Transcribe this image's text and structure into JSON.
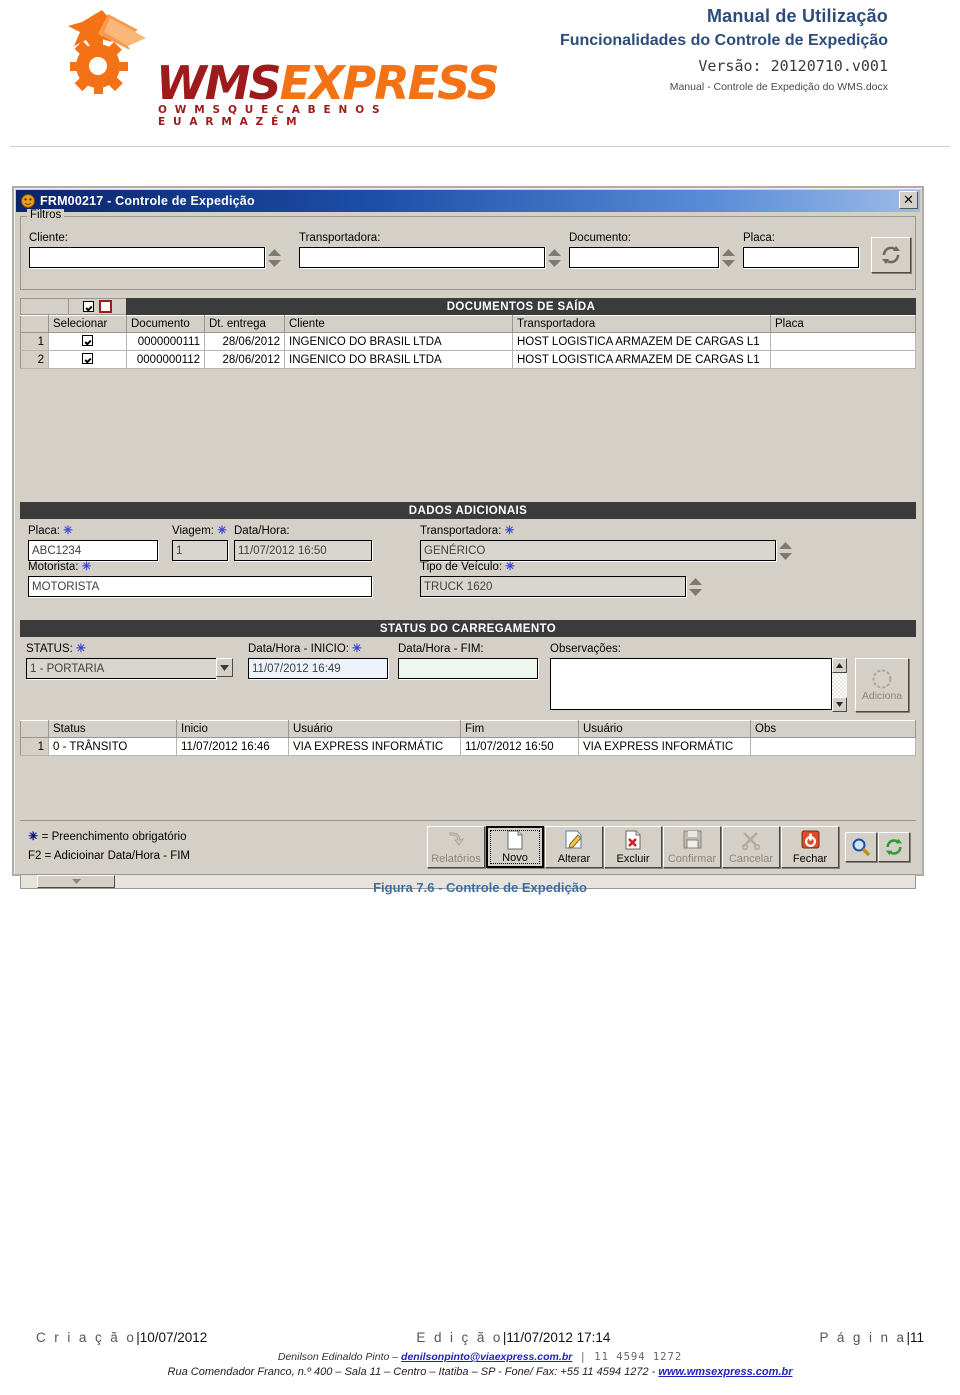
{
  "doc_header": {
    "logo_wms": "WMS",
    "logo_express": "EXPRESS",
    "logo_tagline": "O  W M S   Q U E   C A B E   N O   S E U   A R M A Z É M",
    "line1": "Manual de Utilização",
    "line2": "Funcionalidades do Controle de Expedição",
    "line3": "Versão: 20120710.v001",
    "line4": "Manual - Controle de Expedição do WMS.docx"
  },
  "window": {
    "title": "FRM00217 - Controle de Expedição",
    "close_label": "✕"
  },
  "filters": {
    "legend": "Filtros",
    "cliente_label": "Cliente:",
    "cliente_value": "",
    "transportadora_label": "Transportadora:",
    "transportadora_value": "",
    "documento_label": "Documento:",
    "documento_value": "",
    "placa_label": "Placa:",
    "placa_value": "",
    "refresh_button": "refresh"
  },
  "documents": {
    "section_title": "DOCUMENTOS DE SAÍDA",
    "columns": [
      "",
      "Selecionar",
      "Documento",
      "Dt. entrega",
      "Cliente",
      "Transportadora",
      "Placa"
    ],
    "rows": [
      {
        "no": "1",
        "selected": true,
        "documento": "0000000111",
        "dt_entrega": "28/06/2012",
        "cliente": "INGENICO DO BRASIL LTDA",
        "transportadora": "HOST LOGISTICA ARMAZEM DE CARGAS L1",
        "placa": ""
      },
      {
        "no": "2",
        "selected": true,
        "documento": "0000000112",
        "dt_entrega": "28/06/2012",
        "cliente": "INGENICO DO BRASIL LTDA",
        "transportadora": "HOST LOGISTICA ARMAZEM DE CARGAS L1",
        "placa": ""
      }
    ]
  },
  "dados_adicionais": {
    "section_title": "DADOS ADICIONAIS",
    "placa_label": "Placa:",
    "placa_value": "ABC1234",
    "viagem_label": "Viagem:",
    "viagem_value": "1",
    "datahora_label": "Data/Hora:",
    "datahora_value": "11/07/2012 16:50",
    "transportadora_label": "Transportadora:",
    "transportadora_value": "GENÉRICO",
    "motorista_label": "Motorista:",
    "motorista_value": "MOTORISTA",
    "tipo_veiculo_label": "Tipo de Veículo:",
    "tipo_veiculo_value": "TRUCK 1620"
  },
  "status_carregamento": {
    "section_title": "STATUS DO CARREGAMENTO",
    "status_label": "STATUS:",
    "status_value": "1 - PORTARIA",
    "inicio_label": "Data/Hora - INICIO:",
    "inicio_value": "11/07/2012 16:49",
    "fim_label": "Data/Hora - FIM:",
    "fim_value": "",
    "observacoes_label": "Observações:",
    "observacoes_value": "",
    "adiciona_label": "Adiciona",
    "columns": [
      "",
      "Status",
      "Inicio",
      "Usuário",
      "Fim",
      "Usuário",
      "Obs"
    ],
    "rows": [
      {
        "no": "1",
        "status": "0 - TRÂNSITO",
        "inicio": "11/07/2012 16:46",
        "usuario_inicio": "VIA EXPRESS INFORMÁTIC",
        "fim": "11/07/2012 16:50",
        "usuario_fim": "VIA EXPRESS INFORMÁTIC",
        "obs": ""
      }
    ]
  },
  "hints": {
    "line1": "✳ = Preenchimento obrigatório",
    "line2": "F2 = Adicioinar Data/Hora - FIM"
  },
  "toolbar": {
    "relatorios": "Relatórios",
    "novo": "Novo",
    "alterar": "Alterar",
    "excluir": "Excluir",
    "confirmar": "Confirmar",
    "cancelar": "Cancelar",
    "fechar": "Fechar",
    "search_icon": "magnifier-icon",
    "refresh_icon": "refresh-icon"
  },
  "figure": {
    "caption": "Figura 7.6 - Controle de Expedição"
  },
  "footer": {
    "criacao_label": "C r i a ç ã o",
    "criacao_value": "10/07/2012",
    "edicao_label": "E d i ç ã o",
    "edicao_value": "11/07/2012 17:14",
    "pagina_label": "P á g i n a",
    "pagina_value": "11",
    "contact_name": "Denilson Edinaldo Pinto – ",
    "contact_email": "denilsonpinto@viaexpress.com.br",
    "contact_phone": " | 11  4594  1272",
    "address": "Rua Comendador Franco, n.º 400 – Sala 11 – Centro – Itatiba – SP - Fone/ Fax: +55 11 4594 1272 - ",
    "site": "www.wmsexpress.com.br"
  },
  "colors": {
    "brand_orange": "#f47216",
    "brand_dark_red": "#9e1b1b",
    "header_blue": "#2e4c7a",
    "caption_blue": "#3b6fa8",
    "section_bar": "#3b3b3b",
    "required_asterisk": "#3a45d8",
    "window_face": "#d4d0c8"
  }
}
